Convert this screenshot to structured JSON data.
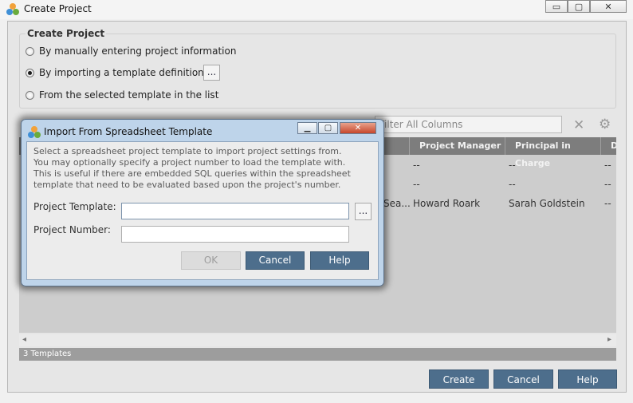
{
  "window": {
    "title": "Create Project",
    "controls": {
      "minimize": "▭",
      "maximize": "▢",
      "close": "✕"
    }
  },
  "group": {
    "title": "Create Project",
    "options": [
      {
        "label": "By manually entering project information",
        "selected": false
      },
      {
        "label": "By importing a template definition",
        "selected": true
      },
      {
        "label": "From the selected template in the list",
        "selected": false
      }
    ],
    "browse_label": "..."
  },
  "filter": {
    "placeholder": "Filter All Columns"
  },
  "icons": {
    "clear": "✕",
    "settings": "⚙"
  },
  "grid": {
    "columns": [
      "Project Manager",
      "Principal in Charge",
      "D"
    ],
    "rows": [
      {
        "partial": "",
        "manager": "--",
        "principal": "--",
        "d": "--"
      },
      {
        "partial": "",
        "manager": "--",
        "principal": "--",
        "d": "--"
      },
      {
        "partial": "Sea...",
        "manager": "Howard Roark",
        "principal": "Sarah Goldstein",
        "d": "--"
      }
    ]
  },
  "scroll": {
    "left": "◂",
    "right": "▸"
  },
  "status": {
    "text": "3 Templates"
  },
  "buttons": {
    "create": "Create",
    "cancel": "Cancel",
    "help": "Help"
  },
  "modal": {
    "title": "Import From Spreadsheet Template",
    "controls": {
      "minimize": "▁",
      "maximize": "▢",
      "close": "✕"
    },
    "description": [
      "Select a spreadsheet project template to import project settings from.",
      "You may optionally specify a project number to load the template with.",
      "This is useful if there are embedded SQL queries within the spreadsheet",
      "template that need to be evaluated based upon the project's number."
    ],
    "template_label": "Project Template:",
    "template_value": "",
    "browse_label": "...",
    "number_label": "Project Number:",
    "number_value": "",
    "ok_label": "OK",
    "cancel_label": "Cancel",
    "help_label": "Help"
  },
  "colors": {
    "button": "#4d6e8c",
    "grid_header": "#7d7d7d",
    "modal_frame": "#bed4ea"
  }
}
